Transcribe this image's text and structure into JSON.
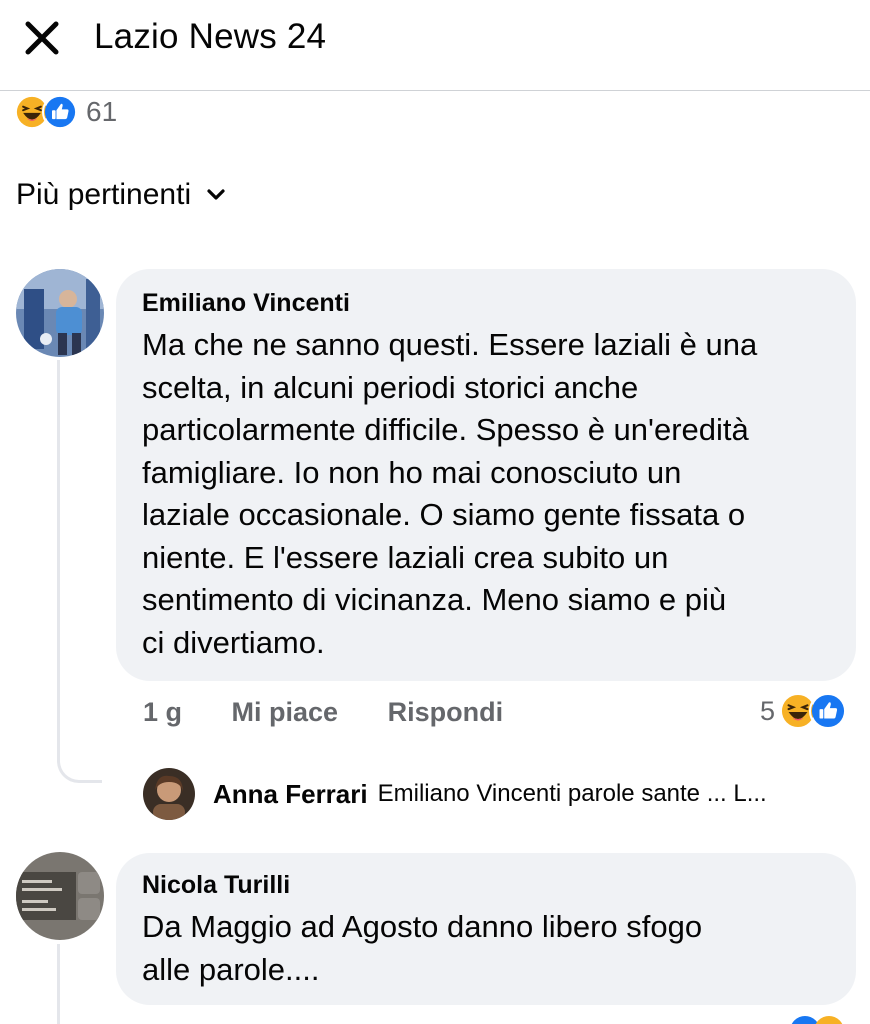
{
  "header": {
    "title": "Lazio News 24",
    "close_icon": "close-icon"
  },
  "post_reactions": {
    "count": "61",
    "icons": [
      "haha-icon",
      "like-icon"
    ]
  },
  "sort": {
    "label": "Più pertinenti",
    "icon": "chevron-down-icon"
  },
  "comments": [
    {
      "author": "Emiliano Vincenti",
      "text": "Ma che ne sanno questi. Essere laziali è una\nscelta, in alcuni periodi storici anche\nparticolarmente  difficile. Spesso è un'eredità\nfamigliare. Io non ho mai conosciuto un\nlaziale occasionale. O siamo gente fissata o\nniente. E l'essere laziali crea subito un\nsentimento di vicinanza. Meno siamo e più\nci divertiamo.",
      "time": "1 g",
      "like_label": "Mi piace",
      "reply_label": "Rispondi",
      "reaction_count": "5",
      "reply": {
        "author": "Anna Ferrari",
        "text": "Emiliano Vincenti parole sante ... L..."
      }
    },
    {
      "author": "Nicola Turilli",
      "text": "Da Maggio ad Agosto danno libero sfogo\nalle parole...."
    }
  ],
  "colors": {
    "accent": "#1877f2",
    "bubble": "#f0f2f5",
    "secondary_text": "#65676b",
    "haha": "#f7b125"
  }
}
